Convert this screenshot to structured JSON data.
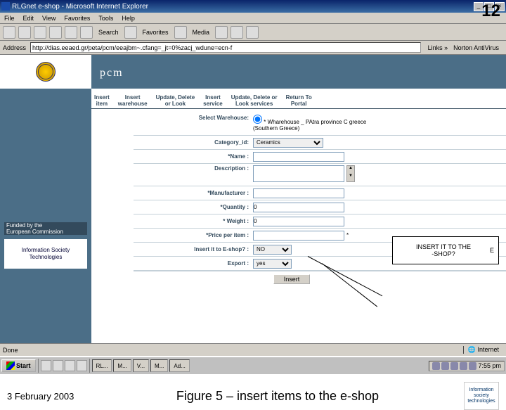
{
  "page_number": "12",
  "window": {
    "title": "RLGnet e-shop - Microsoft Internet Explorer",
    "menus": [
      "File",
      "Edit",
      "View",
      "Favorites",
      "Tools",
      "Help"
    ],
    "toolbar_labels": {
      "search": "Search",
      "favorites": "Favorites",
      "media": "Media"
    },
    "address_label": "Address",
    "url": "http://dias.eeaed.gr/peta/pcm/eeajbm~.cfang=_jt=0%zacj_wdune=ecn-f",
    "links_label": "Links »",
    "norton_label": "Norton AntiVirus"
  },
  "header": {
    "brand": "pcm"
  },
  "nav": {
    "items": [
      "Insert\nitem",
      "Insert\nwarehouse",
      "Update, Delete\nor Look",
      "Insert\nservice",
      "Update, Delete or\nLook services",
      "Return To\nPortal"
    ]
  },
  "form": {
    "warehouse_label": "Select Warehouse:",
    "warehouse_value": "* Wharehouse _ PAtra province C greece",
    "warehouse_sub": "(Southern Greece)",
    "category_label": "Category_id:",
    "category_value": "Ceramics",
    "name_label": "*Name :",
    "name_value": "",
    "description_label": "Description :",
    "description_value": "",
    "manufacturer_label": "*Manufacturer :",
    "manufacturer_value": "",
    "quantity_label": "*Quantity :",
    "quantity_value": "0",
    "weight_label": "* Weight :",
    "weight_value": "0",
    "price_label": "*Price per item :",
    "price_value": "",
    "price_unit": "*",
    "eshop_label": "Insert it to E-shop? :",
    "eshop_value": "NO",
    "export_label": "Export :",
    "export_value": "yes",
    "insert_button": "Insert"
  },
  "sidebar": {
    "funded": "Funded by the\nEuropean Commission",
    "ist": "Information Society\nTechnologies"
  },
  "callout": {
    "main": "INSERT IT TO THE\n-SHOP?",
    "right": "E"
  },
  "statusbar": {
    "done": "Done",
    "zone": "Internet"
  },
  "taskbar": {
    "start": "Start",
    "tasks": [
      "RL...",
      "M...",
      "V...",
      "M...",
      "Ad..."
    ],
    "time": "7:55 pm"
  },
  "caption": {
    "date": "3 February 2003",
    "text": "Figure 5 – insert items to the e-shop",
    "ist": "Information\nsociety\ntechnologies"
  }
}
